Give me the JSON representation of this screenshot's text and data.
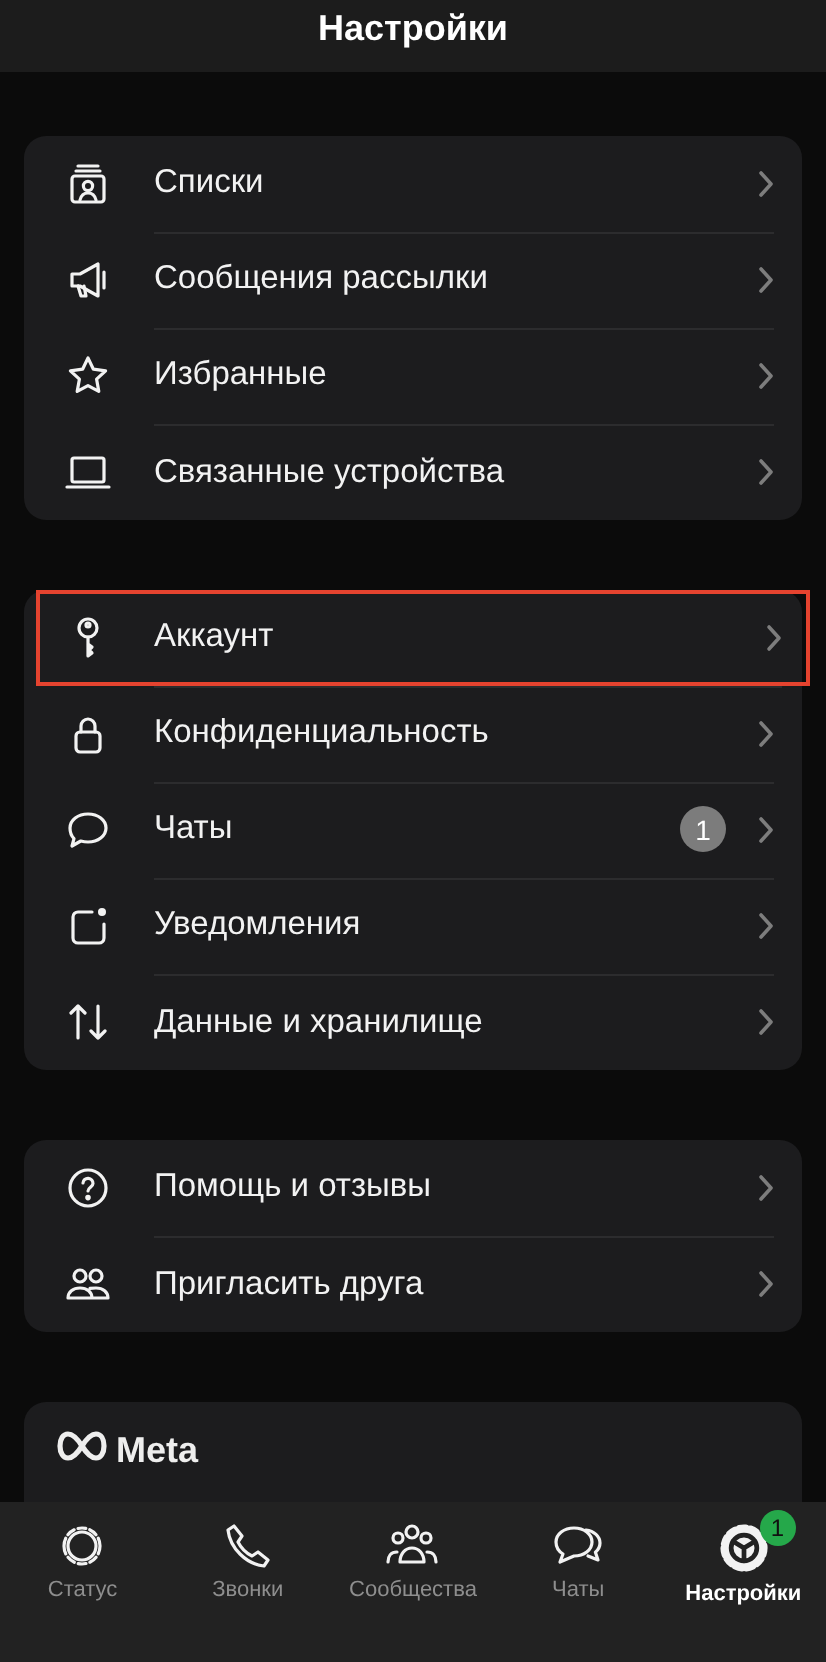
{
  "header": {
    "title": "Настройки"
  },
  "groups": [
    {
      "items": [
        {
          "kind": "lists",
          "label": "Списки",
          "highlighted": false
        },
        {
          "kind": "broadcast",
          "label": "Сообщения рассылки",
          "highlighted": false
        },
        {
          "kind": "star",
          "label": "Избранные",
          "highlighted": false
        },
        {
          "kind": "laptop",
          "label": "Связанные устройства",
          "highlighted": false
        }
      ]
    },
    {
      "items": [
        {
          "kind": "key",
          "label": "Аккаунт",
          "highlighted": true
        },
        {
          "kind": "lock",
          "label": "Конфиденциальность",
          "highlighted": false
        },
        {
          "kind": "chat",
          "label": "Чаты",
          "badge": "1",
          "highlighted": false
        },
        {
          "kind": "notification",
          "label": "Уведомления",
          "highlighted": false
        },
        {
          "kind": "data",
          "label": "Данные и хранилище",
          "highlighted": false
        }
      ]
    },
    {
      "items": [
        {
          "kind": "help",
          "label": "Помощь и отзывы",
          "highlighted": false
        },
        {
          "kind": "invite",
          "label": "Пригласить друга",
          "highlighted": false
        }
      ]
    }
  ],
  "meta_card": {
    "brand": "Meta"
  },
  "tab_bar": [
    {
      "kind": "status",
      "label": "Статус",
      "selected": false
    },
    {
      "kind": "calls",
      "label": "Звонки",
      "selected": false
    },
    {
      "kind": "communities",
      "label": "Сообщества",
      "selected": false
    },
    {
      "kind": "chats",
      "label": "Чаты",
      "selected": false
    },
    {
      "kind": "settings",
      "label": "Настройки",
      "selected": true,
      "badge": "1"
    }
  ]
}
